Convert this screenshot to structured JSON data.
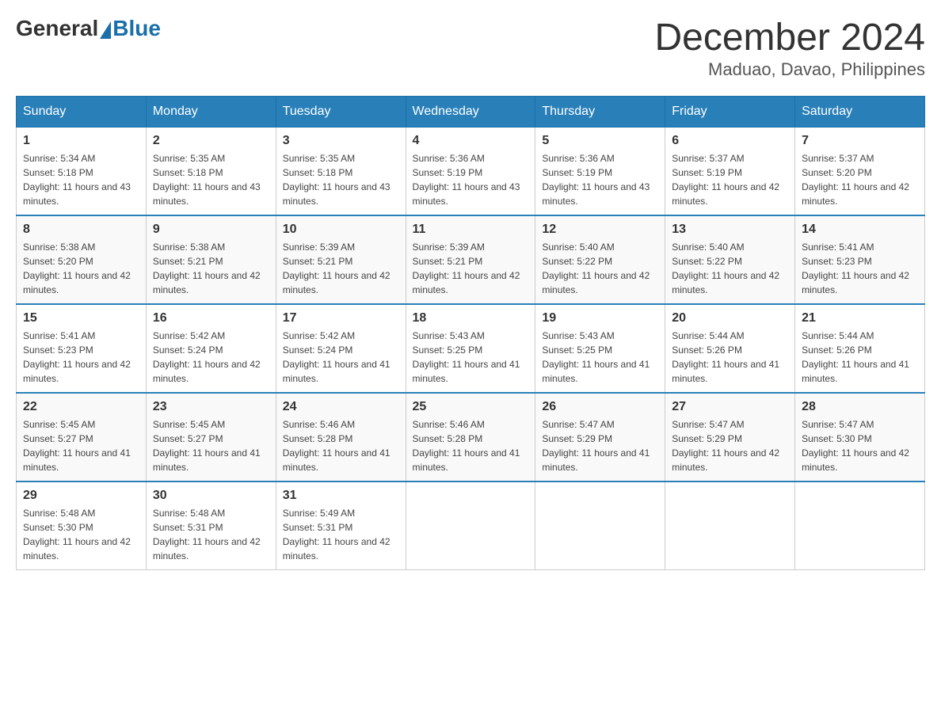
{
  "logo": {
    "general": "General",
    "blue": "Blue"
  },
  "title": "December 2024",
  "subtitle": "Maduao, Davao, Philippines",
  "weekdays": [
    "Sunday",
    "Monday",
    "Tuesday",
    "Wednesday",
    "Thursday",
    "Friday",
    "Saturday"
  ],
  "weeks": [
    [
      {
        "day": "1",
        "sunrise": "Sunrise: 5:34 AM",
        "sunset": "Sunset: 5:18 PM",
        "daylight": "Daylight: 11 hours and 43 minutes."
      },
      {
        "day": "2",
        "sunrise": "Sunrise: 5:35 AM",
        "sunset": "Sunset: 5:18 PM",
        "daylight": "Daylight: 11 hours and 43 minutes."
      },
      {
        "day": "3",
        "sunrise": "Sunrise: 5:35 AM",
        "sunset": "Sunset: 5:18 PM",
        "daylight": "Daylight: 11 hours and 43 minutes."
      },
      {
        "day": "4",
        "sunrise": "Sunrise: 5:36 AM",
        "sunset": "Sunset: 5:19 PM",
        "daylight": "Daylight: 11 hours and 43 minutes."
      },
      {
        "day": "5",
        "sunrise": "Sunrise: 5:36 AM",
        "sunset": "Sunset: 5:19 PM",
        "daylight": "Daylight: 11 hours and 43 minutes."
      },
      {
        "day": "6",
        "sunrise": "Sunrise: 5:37 AM",
        "sunset": "Sunset: 5:19 PM",
        "daylight": "Daylight: 11 hours and 42 minutes."
      },
      {
        "day": "7",
        "sunrise": "Sunrise: 5:37 AM",
        "sunset": "Sunset: 5:20 PM",
        "daylight": "Daylight: 11 hours and 42 minutes."
      }
    ],
    [
      {
        "day": "8",
        "sunrise": "Sunrise: 5:38 AM",
        "sunset": "Sunset: 5:20 PM",
        "daylight": "Daylight: 11 hours and 42 minutes."
      },
      {
        "day": "9",
        "sunrise": "Sunrise: 5:38 AM",
        "sunset": "Sunset: 5:21 PM",
        "daylight": "Daylight: 11 hours and 42 minutes."
      },
      {
        "day": "10",
        "sunrise": "Sunrise: 5:39 AM",
        "sunset": "Sunset: 5:21 PM",
        "daylight": "Daylight: 11 hours and 42 minutes."
      },
      {
        "day": "11",
        "sunrise": "Sunrise: 5:39 AM",
        "sunset": "Sunset: 5:21 PM",
        "daylight": "Daylight: 11 hours and 42 minutes."
      },
      {
        "day": "12",
        "sunrise": "Sunrise: 5:40 AM",
        "sunset": "Sunset: 5:22 PM",
        "daylight": "Daylight: 11 hours and 42 minutes."
      },
      {
        "day": "13",
        "sunrise": "Sunrise: 5:40 AM",
        "sunset": "Sunset: 5:22 PM",
        "daylight": "Daylight: 11 hours and 42 minutes."
      },
      {
        "day": "14",
        "sunrise": "Sunrise: 5:41 AM",
        "sunset": "Sunset: 5:23 PM",
        "daylight": "Daylight: 11 hours and 42 minutes."
      }
    ],
    [
      {
        "day": "15",
        "sunrise": "Sunrise: 5:41 AM",
        "sunset": "Sunset: 5:23 PM",
        "daylight": "Daylight: 11 hours and 42 minutes."
      },
      {
        "day": "16",
        "sunrise": "Sunrise: 5:42 AM",
        "sunset": "Sunset: 5:24 PM",
        "daylight": "Daylight: 11 hours and 42 minutes."
      },
      {
        "day": "17",
        "sunrise": "Sunrise: 5:42 AM",
        "sunset": "Sunset: 5:24 PM",
        "daylight": "Daylight: 11 hours and 41 minutes."
      },
      {
        "day": "18",
        "sunrise": "Sunrise: 5:43 AM",
        "sunset": "Sunset: 5:25 PM",
        "daylight": "Daylight: 11 hours and 41 minutes."
      },
      {
        "day": "19",
        "sunrise": "Sunrise: 5:43 AM",
        "sunset": "Sunset: 5:25 PM",
        "daylight": "Daylight: 11 hours and 41 minutes."
      },
      {
        "day": "20",
        "sunrise": "Sunrise: 5:44 AM",
        "sunset": "Sunset: 5:26 PM",
        "daylight": "Daylight: 11 hours and 41 minutes."
      },
      {
        "day": "21",
        "sunrise": "Sunrise: 5:44 AM",
        "sunset": "Sunset: 5:26 PM",
        "daylight": "Daylight: 11 hours and 41 minutes."
      }
    ],
    [
      {
        "day": "22",
        "sunrise": "Sunrise: 5:45 AM",
        "sunset": "Sunset: 5:27 PM",
        "daylight": "Daylight: 11 hours and 41 minutes."
      },
      {
        "day": "23",
        "sunrise": "Sunrise: 5:45 AM",
        "sunset": "Sunset: 5:27 PM",
        "daylight": "Daylight: 11 hours and 41 minutes."
      },
      {
        "day": "24",
        "sunrise": "Sunrise: 5:46 AM",
        "sunset": "Sunset: 5:28 PM",
        "daylight": "Daylight: 11 hours and 41 minutes."
      },
      {
        "day": "25",
        "sunrise": "Sunrise: 5:46 AM",
        "sunset": "Sunset: 5:28 PM",
        "daylight": "Daylight: 11 hours and 41 minutes."
      },
      {
        "day": "26",
        "sunrise": "Sunrise: 5:47 AM",
        "sunset": "Sunset: 5:29 PM",
        "daylight": "Daylight: 11 hours and 41 minutes."
      },
      {
        "day": "27",
        "sunrise": "Sunrise: 5:47 AM",
        "sunset": "Sunset: 5:29 PM",
        "daylight": "Daylight: 11 hours and 42 minutes."
      },
      {
        "day": "28",
        "sunrise": "Sunrise: 5:47 AM",
        "sunset": "Sunset: 5:30 PM",
        "daylight": "Daylight: 11 hours and 42 minutes."
      }
    ],
    [
      {
        "day": "29",
        "sunrise": "Sunrise: 5:48 AM",
        "sunset": "Sunset: 5:30 PM",
        "daylight": "Daylight: 11 hours and 42 minutes."
      },
      {
        "day": "30",
        "sunrise": "Sunrise: 5:48 AM",
        "sunset": "Sunset: 5:31 PM",
        "daylight": "Daylight: 11 hours and 42 minutes."
      },
      {
        "day": "31",
        "sunrise": "Sunrise: 5:49 AM",
        "sunset": "Sunset: 5:31 PM",
        "daylight": "Daylight: 11 hours and 42 minutes."
      },
      null,
      null,
      null,
      null
    ]
  ]
}
